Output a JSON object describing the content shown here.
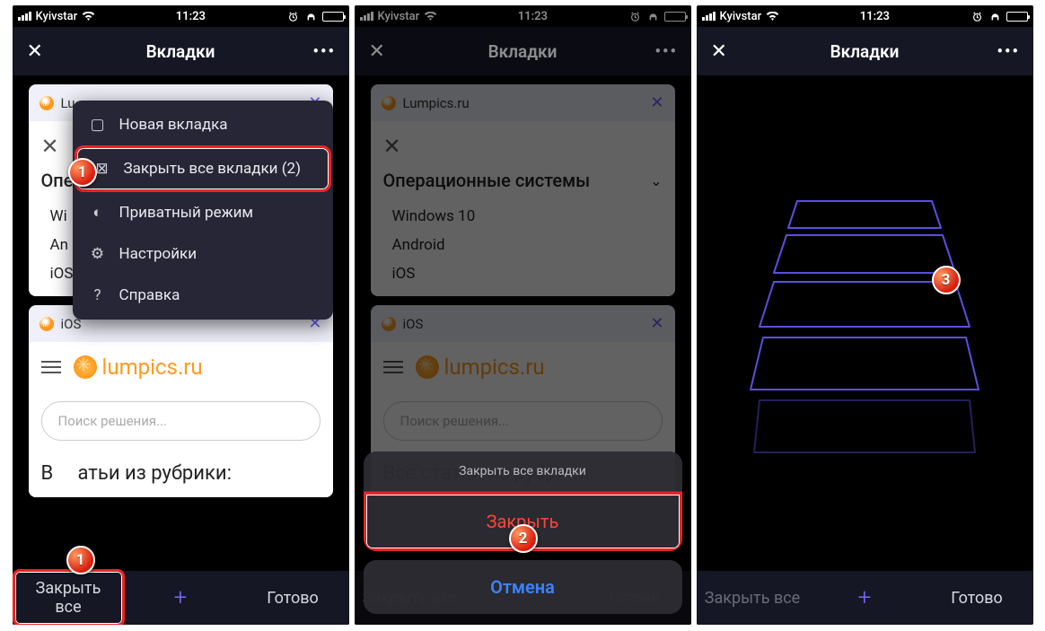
{
  "status": {
    "carrier": "Kyivstar",
    "time": "11:23"
  },
  "nav": {
    "title": "Вкладки"
  },
  "menu": {
    "new_tab": "Новая вкладка",
    "close_all": "Закрыть все вкладки (2)",
    "private": "Приватный режим",
    "settings": "Настройки",
    "help": "Справка"
  },
  "tab1": {
    "title_short": "Lu",
    "title_full": "Lumpics.ru",
    "section": "Операционные системы",
    "items_short": [
      "Wi",
      "An",
      "iOS"
    ],
    "items_full": [
      "Windows 10",
      "Android",
      "iOS"
    ]
  },
  "tab2": {
    "title": "iOS",
    "logo": "lumpics.ru",
    "search_placeholder": "Поиск решения...",
    "rubric_full": "Все статьи из рубрики:",
    "rubric_partial": "Все статьи из рубрики:"
  },
  "bottom": {
    "close_all": "Закрыть все",
    "done": "Готово"
  },
  "sheet": {
    "title": "Закрыть все вкладки",
    "action": "Закрыть",
    "cancel": "Отмена"
  },
  "steps": {
    "one": "1",
    "one_b": "1",
    "two": "2",
    "three": "3"
  }
}
